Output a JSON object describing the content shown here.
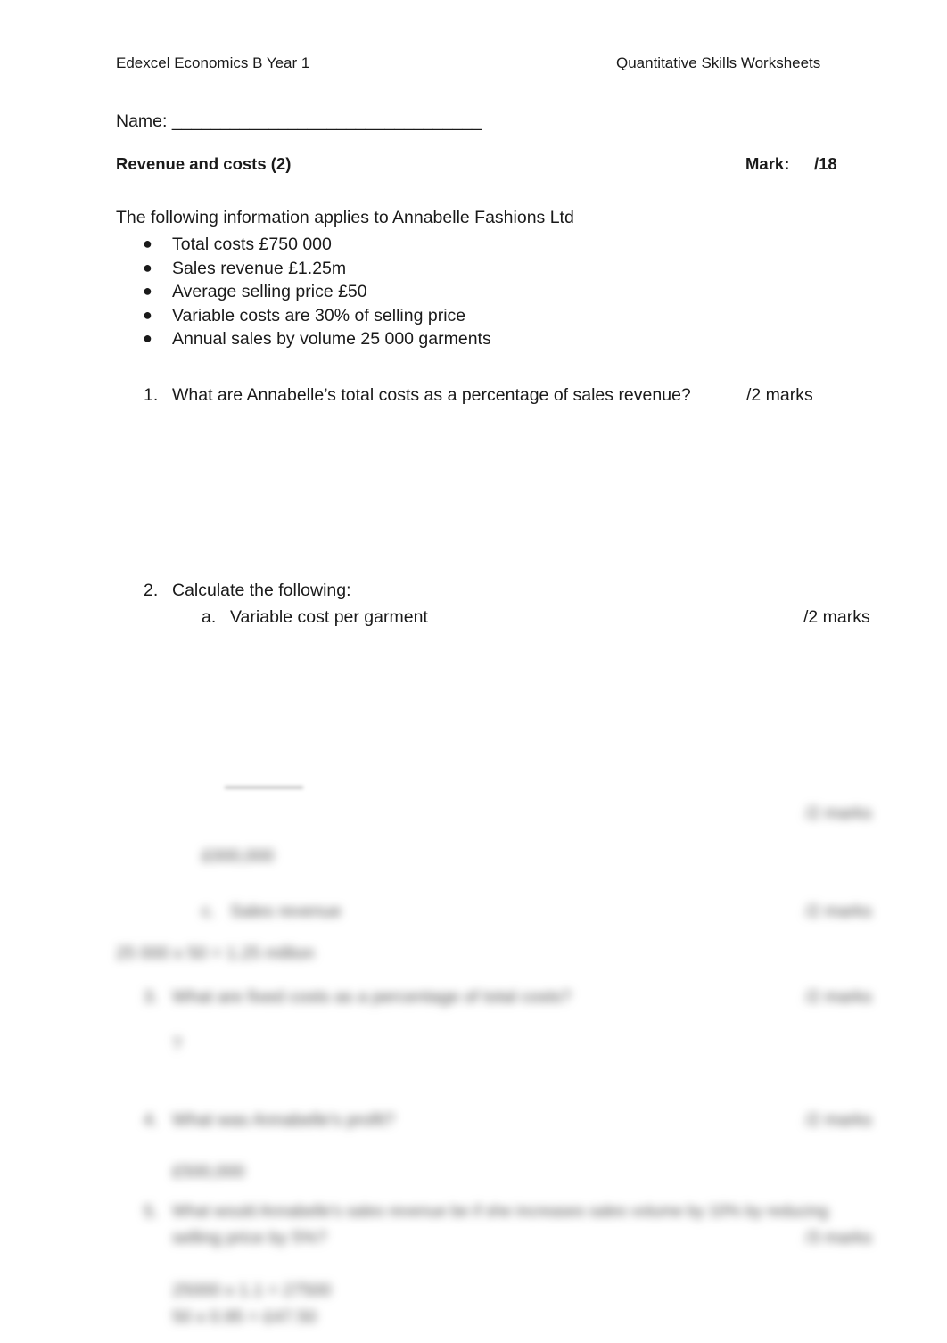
{
  "header": {
    "left": "Edexcel Economics B Year 1",
    "right": "Quantitative Skills  Worksheets"
  },
  "name_field": {
    "label": "Name:",
    "blank": "________________________________"
  },
  "title": "Revenue and costs (2)",
  "mark": {
    "label": "Mark:",
    "total": "/18"
  },
  "intro": "The following information applies to Annabelle Fashions Ltd",
  "bullets": [
    "Total costs £750 000",
    "Sales revenue £1.25m",
    "Average selling price £50",
    "Variable costs are 30% of selling price",
    "Annual sales by volume 25 000 garments"
  ],
  "questions": {
    "q1": {
      "number": "1.",
      "text": "What are Annabelle’s total costs as a percentage of sales revenue?",
      "marks": "/2 marks"
    },
    "q2": {
      "number": "2.",
      "text": "Calculate the following:",
      "a": {
        "letter": "a.",
        "text": "Variable cost per garment",
        "marks": "/2 marks"
      }
    }
  },
  "blurred_preview": {
    "marks_1": "/2 marks",
    "answer_1": "£000,000",
    "part_c_letter": "c.",
    "part_c_text": "Sales revenue",
    "marks_2": "/2 marks",
    "answer_2": "25 000 x 50 = 1.25 million",
    "q3_number": "3.",
    "q3_text": "What are fixed costs as a percentage of total costs?",
    "marks_3": "/2 marks",
    "answer_3": "?",
    "q4_number": "4.",
    "q4_text": "What was Annabelle's profit?",
    "marks_4": "/2 marks",
    "answer_4": "£500,000",
    "q5_number": "5.",
    "q5_text_line1": "What would Annabelle's sales revenue be if she increases sales volume by 10% by reducing",
    "q5_text_line2": "selling price by 5%?",
    "marks_5": "/3 marks",
    "answer_5_line1": "25000 x 1.1 = 27500",
    "answer_5_line2": "50 x 0.95 = £47.50"
  }
}
